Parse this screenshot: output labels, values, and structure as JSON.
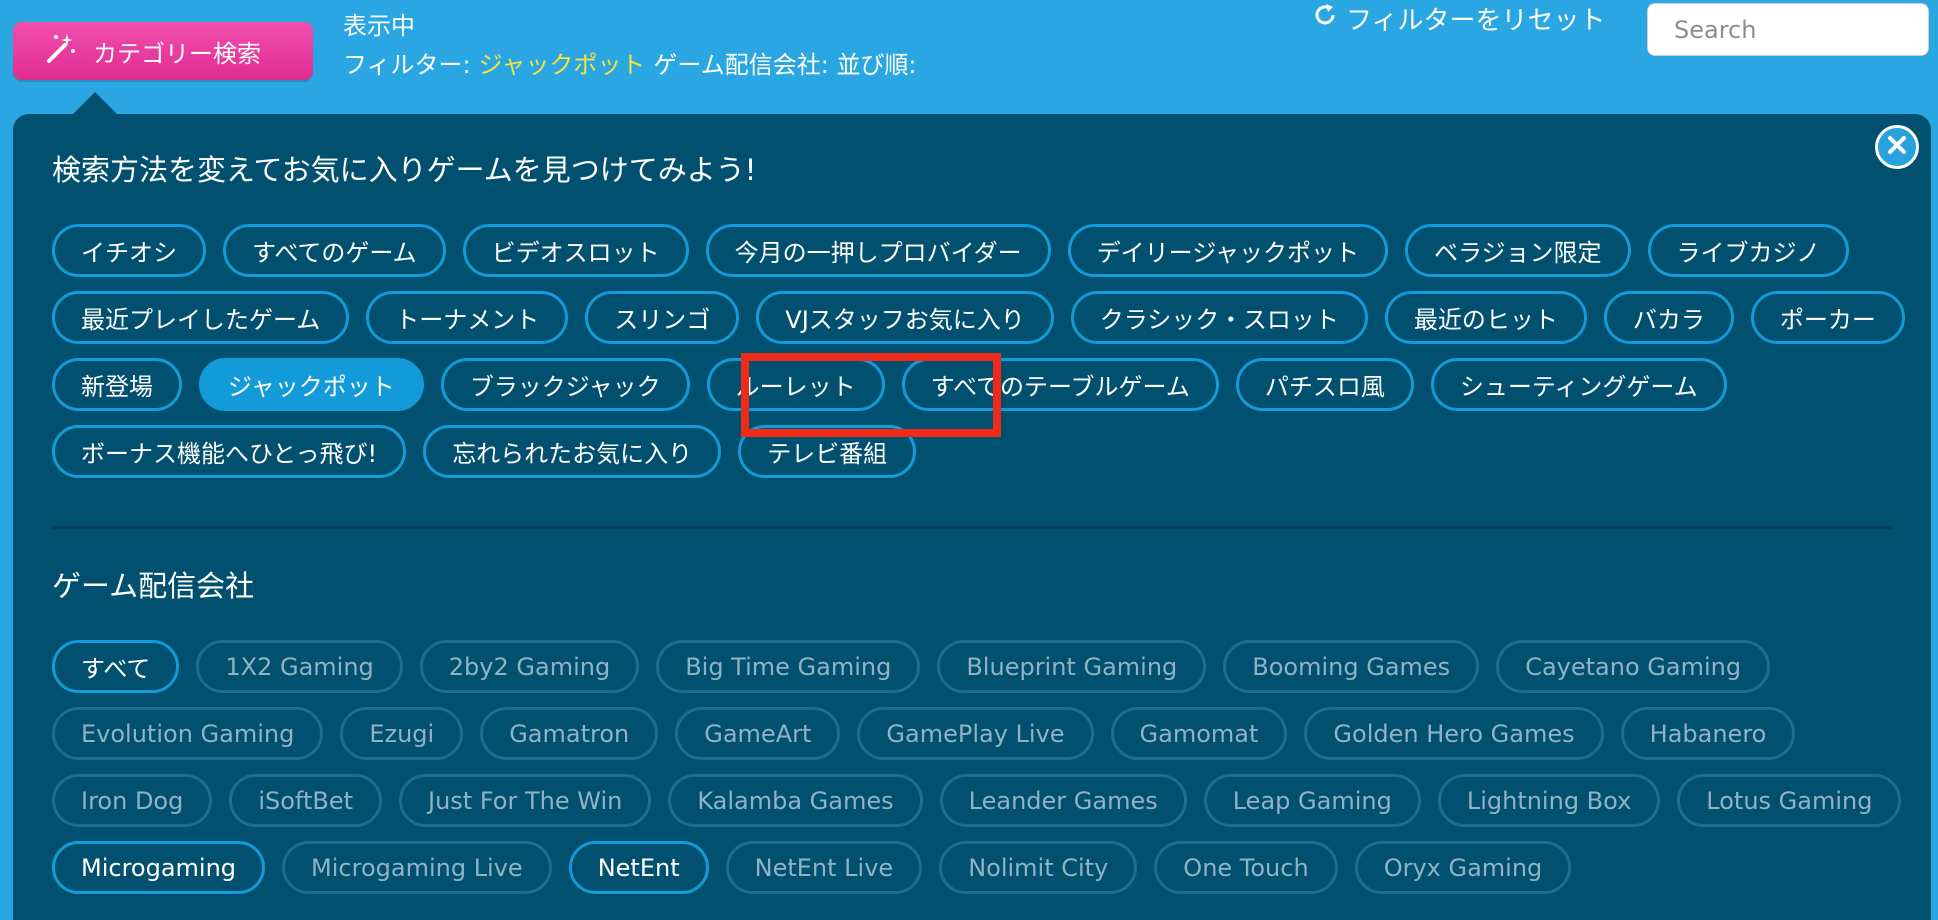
{
  "header": {
    "category_button_label": "カテゴリー検索",
    "status_label": "表示中",
    "filter_label": "フィルター:",
    "filter_value": "ジャックポット",
    "provider_label": "ゲーム配信会社:",
    "sort_label": "並び順:",
    "reset_label": "フィルターをリセット",
    "search_placeholder": "Search"
  },
  "panel": {
    "title": "検索方法を変えてお気に入りゲームを見つけてみよう!",
    "provider_section_title": "ゲーム配信会社",
    "categories": [
      {
        "label": "イチオシ",
        "active": false
      },
      {
        "label": "すべてのゲーム",
        "active": false
      },
      {
        "label": "ビデオスロット",
        "active": false
      },
      {
        "label": "今月の一押しプロバイダー",
        "active": false
      },
      {
        "label": "デイリージャックポット",
        "active": false
      },
      {
        "label": "ベラジョン限定",
        "active": false
      },
      {
        "label": "ライブカジノ",
        "active": false
      },
      {
        "label": "最近プレイしたゲーム",
        "active": false
      },
      {
        "label": "トーナメント",
        "active": false
      },
      {
        "label": "スリンゴ",
        "active": false
      },
      {
        "label": "VJスタッフお気に入り",
        "active": false
      },
      {
        "label": "クラシック・スロット",
        "active": false
      },
      {
        "label": "最近のヒット",
        "active": false
      },
      {
        "label": "バカラ",
        "active": false
      },
      {
        "label": "ポーカー",
        "active": false
      },
      {
        "label": "新登場",
        "active": false
      },
      {
        "label": "ジャックポット",
        "active": true
      },
      {
        "label": "ブラックジャック",
        "active": false
      },
      {
        "label": "ルーレット",
        "active": false
      },
      {
        "label": "すべてのテーブルゲーム",
        "active": false
      },
      {
        "label": "パチスロ風",
        "active": false
      },
      {
        "label": "シューティングゲーム",
        "active": false
      },
      {
        "label": "ボーナス機能へひとっ飛び!",
        "active": false
      },
      {
        "label": "忘れられたお気に入り",
        "active": false
      },
      {
        "label": "テレビ番組",
        "active": false
      }
    ],
    "providers": [
      {
        "label": "すべて",
        "selected": true
      },
      {
        "label": "1X2 Gaming",
        "selected": false
      },
      {
        "label": "2by2 Gaming",
        "selected": false
      },
      {
        "label": "Big Time Gaming",
        "selected": false
      },
      {
        "label": "Blueprint Gaming",
        "selected": false
      },
      {
        "label": "Booming Games",
        "selected": false
      },
      {
        "label": "Cayetano Gaming",
        "selected": false
      },
      {
        "label": "Evolution Gaming",
        "selected": false
      },
      {
        "label": "Ezugi",
        "selected": false
      },
      {
        "label": "Gamatron",
        "selected": false
      },
      {
        "label": "GameArt",
        "selected": false
      },
      {
        "label": "GamePlay Live",
        "selected": false
      },
      {
        "label": "Gamomat",
        "selected": false
      },
      {
        "label": "Golden Hero Games",
        "selected": false
      },
      {
        "label": "Habanero",
        "selected": false
      },
      {
        "label": "Iron Dog",
        "selected": false
      },
      {
        "label": "iSoftBet",
        "selected": false
      },
      {
        "label": "Just For The Win",
        "selected": false
      },
      {
        "label": "Kalamba Games",
        "selected": false
      },
      {
        "label": "Leander Games",
        "selected": false
      },
      {
        "label": "Leap Gaming",
        "selected": false
      },
      {
        "label": "Lightning Box",
        "selected": false
      },
      {
        "label": "Lotus Gaming",
        "selected": false
      },
      {
        "label": "Microgaming",
        "selected": true
      },
      {
        "label": "Microgaming Live",
        "selected": false
      },
      {
        "label": "NetEnt",
        "selected": true
      },
      {
        "label": "NetEnt Live",
        "selected": false
      },
      {
        "label": "Nolimit City",
        "selected": false
      },
      {
        "label": "One Touch",
        "selected": false
      },
      {
        "label": "Oryx Gaming",
        "selected": false
      }
    ]
  },
  "colors": {
    "page_background": "#2aa7e3",
    "panel_background": "#02506f",
    "accent_pink": "#e92f96",
    "chip_border": "#139bd9",
    "filter_highlight": "#f7e23f",
    "annotation_red": "#ef2a18"
  },
  "icons": {
    "category_button": "magic-wand-icon",
    "reset": "refresh-icon",
    "close": "close-icon"
  }
}
